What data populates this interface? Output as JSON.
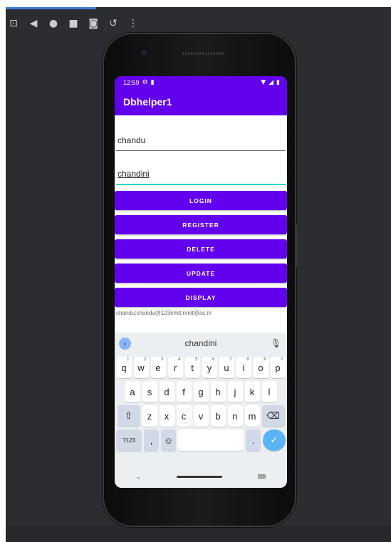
{
  "emulator_toolbar": {
    "icons": [
      "layout-icon",
      "back-icon",
      "home-icon",
      "overview-icon",
      "camera-icon",
      "rotate-icon",
      "more-icon"
    ],
    "glyphs": [
      "⊡",
      "◀",
      "●",
      "■",
      "◙",
      "↺",
      "⋮"
    ]
  },
  "status_bar": {
    "time": "12:59",
    "left_icons": [
      "settings-gear-icon",
      "sim-card-icon"
    ],
    "right_icons": [
      "wifi-icon",
      "signal-icon",
      "battery-icon"
    ]
  },
  "app": {
    "title": "Dbhelper1",
    "accent": "#6200ee",
    "field_accent": "#03dac5"
  },
  "form": {
    "username_value": "chandu",
    "password_value": "chandini"
  },
  "buttons": {
    "login": "LOGIN",
    "register": "REGISTER",
    "delete": "DELETE",
    "update": "UPDATE",
    "display": "DISPLAY"
  },
  "result_text": "chandu:chandu@123nmit:nmit@ac.in",
  "keyboard": {
    "suggestion": "chandini",
    "row1": [
      {
        "key": "q",
        "hint": "1"
      },
      {
        "key": "w",
        "hint": "2"
      },
      {
        "key": "e",
        "hint": "3"
      },
      {
        "key": "r",
        "hint": "4"
      },
      {
        "key": "t",
        "hint": "5"
      },
      {
        "key": "y",
        "hint": "6"
      },
      {
        "key": "u",
        "hint": "7"
      },
      {
        "key": "i",
        "hint": "8"
      },
      {
        "key": "o",
        "hint": "9"
      },
      {
        "key": "p",
        "hint": "0"
      }
    ],
    "row2": [
      "a",
      "s",
      "d",
      "f",
      "g",
      "h",
      "j",
      "k",
      "l"
    ],
    "row3": [
      "z",
      "x",
      "c",
      "v",
      "b",
      "n",
      "m"
    ],
    "symbols_label": "?123",
    "comma": ",",
    "period": ".",
    "emoji_glyph": "☺",
    "shift_glyph": "⇧",
    "backspace_glyph": "⌫",
    "enter_glyph": "✓"
  }
}
